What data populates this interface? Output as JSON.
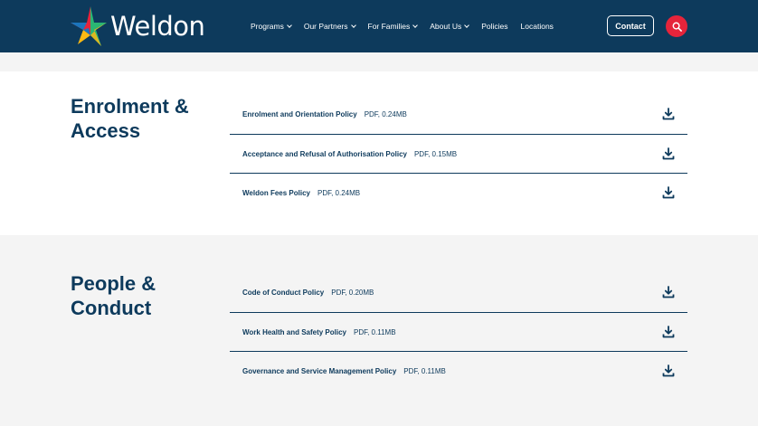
{
  "header": {
    "logo_text": "Weldon",
    "nav": [
      {
        "label": "Programs",
        "has_dropdown": true
      },
      {
        "label": "Our Partners",
        "has_dropdown": true
      },
      {
        "label": "For Families",
        "has_dropdown": true
      },
      {
        "label": "About Us",
        "has_dropdown": true
      },
      {
        "label": "Policies",
        "has_dropdown": false
      },
      {
        "label": "Locations",
        "has_dropdown": false
      }
    ],
    "contact_label": "Contact",
    "search_icon": "search-icon"
  },
  "sections": [
    {
      "title": "Enrolment & Access",
      "documents": [
        {
          "name": "Enrolment and Orientation Policy",
          "meta": "PDF, 0.24MB"
        },
        {
          "name": "Acceptance and Refusal of Authorisation Policy",
          "meta": "PDF, 0.15MB"
        },
        {
          "name": "Weldon Fees Policy",
          "meta": "PDF, 0.24MB"
        }
      ]
    },
    {
      "title": "People & Conduct",
      "documents": [
        {
          "name": "Code of Conduct Policy",
          "meta": "PDF, 0.20MB"
        },
        {
          "name": "Work Health and Safety Policy",
          "meta": "PDF, 0.11MB"
        },
        {
          "name": "Governance and Service Management Policy",
          "meta": "PDF, 0.11MB"
        }
      ]
    }
  ],
  "colors": {
    "navy": "#0d3a5c",
    "red": "#e5243b",
    "white": "#ffffff",
    "light_bg": "#f4f4f4"
  }
}
